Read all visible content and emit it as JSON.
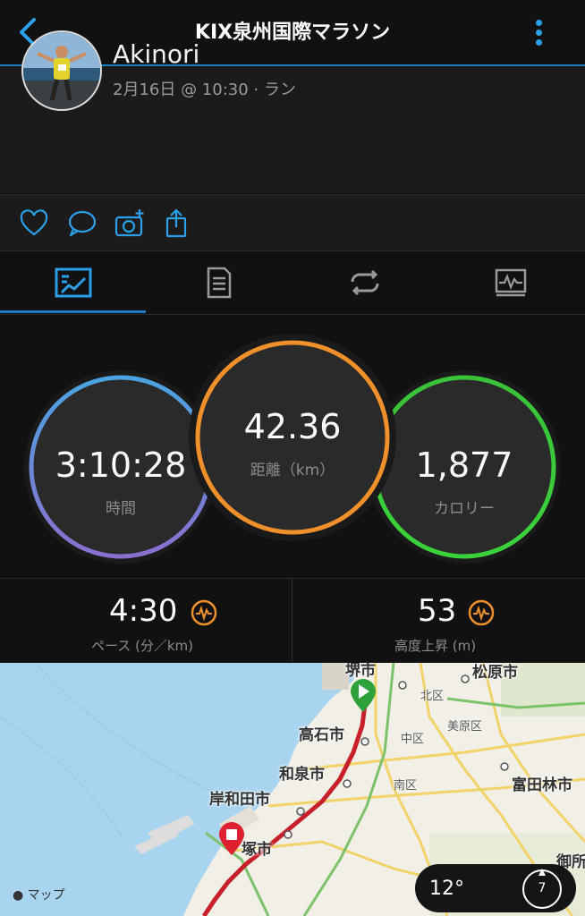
{
  "header": {
    "title": "KIX泉州国際マラソン"
  },
  "profile": {
    "name": "Akinori",
    "meta": "2月16日 @ 10:30 · ラン"
  },
  "stats": {
    "time": {
      "value": "3:10:28",
      "label": "時間"
    },
    "distance": {
      "value": "42.36",
      "label": "距離（km）"
    },
    "calories": {
      "value": "1,877",
      "label": "カロリー"
    }
  },
  "metrics": {
    "pace": {
      "value": "4:30",
      "label": "ペース (分／km)"
    },
    "elevation": {
      "value": "53",
      "label": "高度上昇 (m)"
    }
  },
  "map": {
    "labels": {
      "sakai": "堺市",
      "matsubara": "松原市",
      "kita": "北区",
      "takaishi": "高石市",
      "mihara": "美原区",
      "naka": "中区",
      "izumi": "和泉市",
      "tondabayashi": "富田林市",
      "minami": "南区",
      "kishiwada": "岸和田市",
      "kaizuka": "塚市",
      "gose": "御所",
      "attribution": "マップ"
    },
    "weather": {
      "temp": "12°",
      "wind": "7"
    }
  },
  "colors": {
    "accent": "#1c7fc2",
    "time_ring": "#5a8fd8",
    "distance_ring": "#f0902a",
    "calories_ring": "#3ac23a",
    "sea": "#a8d4f0",
    "route": "#c8202a"
  }
}
